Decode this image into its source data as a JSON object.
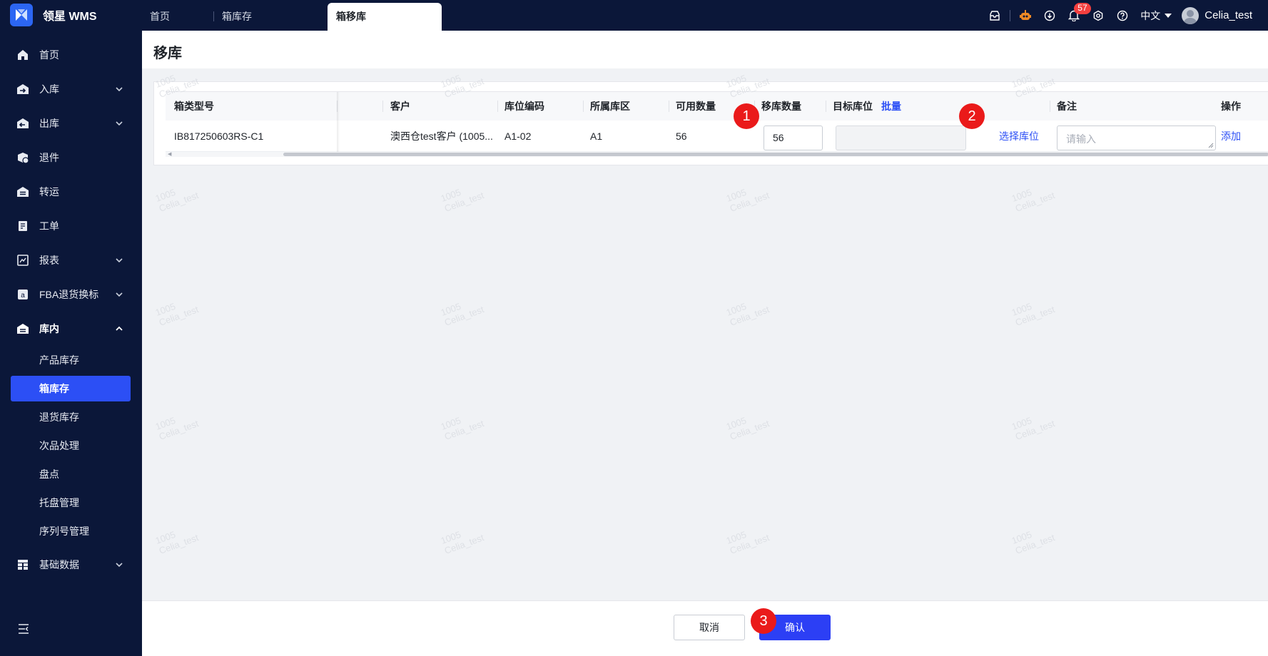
{
  "app": {
    "brand_name": "领星 WMS"
  },
  "tabs": [
    {
      "label": "首页"
    },
    {
      "label": "箱库存"
    },
    {
      "label": "箱移库"
    }
  ],
  "topbar": {
    "notification_count": "57",
    "language": "中文",
    "username": "Celia_test"
  },
  "sidebar": {
    "items": [
      {
        "label": "首页"
      },
      {
        "label": "入库"
      },
      {
        "label": "出库"
      },
      {
        "label": "退件"
      },
      {
        "label": "转运"
      },
      {
        "label": "工单"
      },
      {
        "label": "报表"
      },
      {
        "label": "FBA退货换标"
      },
      {
        "label": "库内"
      },
      {
        "label": "基础数据"
      }
    ],
    "sub_items": [
      {
        "label": "产品库存"
      },
      {
        "label": "箱库存"
      },
      {
        "label": "退货库存"
      },
      {
        "label": "次品处理"
      },
      {
        "label": "盘点"
      },
      {
        "label": "托盘管理"
      },
      {
        "label": "序列号管理"
      }
    ]
  },
  "page": {
    "title": "移库"
  },
  "table": {
    "headers": {
      "box_type": "箱类型号",
      "customer": "客户",
      "location_code": "库位编码",
      "zone": "所属库区",
      "available_qty": "可用数量",
      "move_qty": "移库数量",
      "target_location": "目标库位",
      "batch": "批量",
      "remark": "备注",
      "action": "操作"
    },
    "row": {
      "box_type": "IB817250603RS-C1",
      "customer": "澳西仓test客户 (1005...",
      "location_code": "A1-02",
      "zone": "A1",
      "available_qty": "56",
      "move_qty": "56",
      "target_location": "",
      "select_location": "选择库位",
      "remark_placeholder": "请输入",
      "add": "添加"
    }
  },
  "markers": [
    "1",
    "2",
    "3"
  ],
  "footer": {
    "cancel": "取消",
    "confirm": "确认"
  },
  "watermark": {
    "line1": "1005",
    "line2": "Celia_test"
  }
}
